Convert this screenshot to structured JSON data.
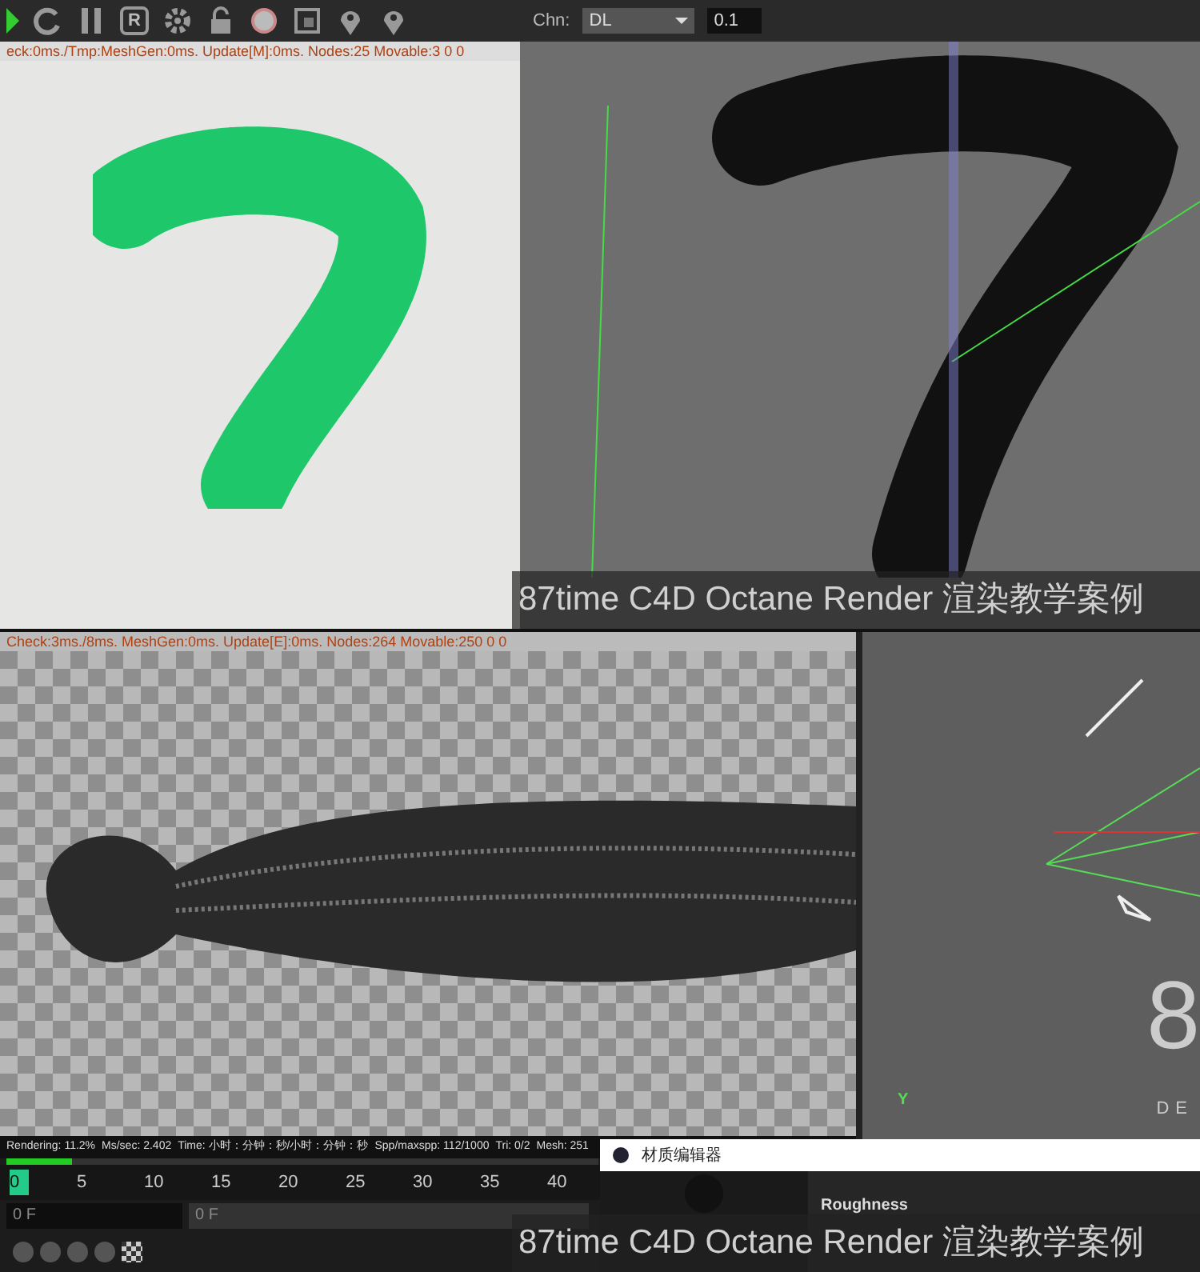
{
  "top_render_viewer": {
    "toolbar": {
      "r_icon_label": "R",
      "channel_label": "Chn:",
      "channel_value": "DL",
      "value_field": "0.1"
    },
    "status_line": "eck:0ms./Tmp:MeshGen:0ms. Update[M]:0ms. Nodes:25 Movable:3  0 0"
  },
  "top_caption": "87time C4D Octane Render 渲染教学案例",
  "bottom_render_viewer": {
    "status_line": "Check:3ms./8ms. MeshGen:0ms. Update[E]:0ms. Nodes:264 Movable:250  0 0",
    "stats": {
      "rendering": "Rendering: 11.2%",
      "level": 0.112,
      "ms_sec": "Ms/sec: 2.402",
      "time": "Time: 小时：分钟：秒/小时：分钟：秒",
      "spp": "Spp/maxspp: 112/1000",
      "tri": "Tri: 0/2",
      "mesh": "Mesh: 251"
    },
    "timeline_ticks": [
      "0",
      "5",
      "10",
      "15",
      "20",
      "25",
      "30",
      "35",
      "40"
    ],
    "frame_fields": [
      "0 F",
      "0 F"
    ]
  },
  "bottom_viewport": {
    "axis_label": "Y",
    "big_digit": "8",
    "small_text": "DE"
  },
  "material_editor": {
    "title": "材质编辑器",
    "section": "Roughness"
  },
  "bottom_caption": "87time C4D Octane Render 渲染教学案例"
}
